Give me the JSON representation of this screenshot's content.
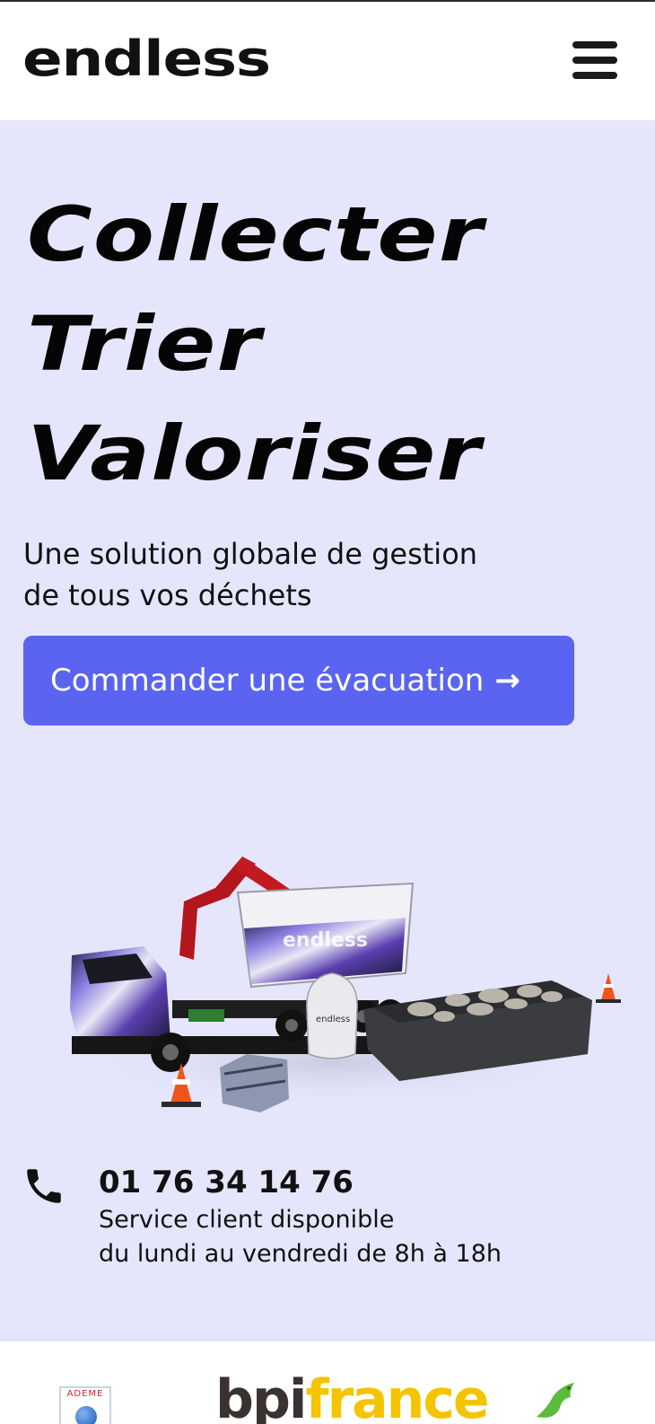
{
  "header": {
    "logo_text": "endless",
    "menu_icon": "hamburger-menu-icon"
  },
  "hero": {
    "headline_lines": [
      "Collecter",
      "Trier",
      "Valoriser"
    ],
    "subtitle_lines": [
      "Une solution globale de gestion",
      "de tous vos déchets"
    ],
    "cta_label": "Commander une évacuation",
    "cta_arrow": "→",
    "truck_brand_text": "endless",
    "bag_label": "endless"
  },
  "contact": {
    "phone_icon": "phone-icon",
    "phone_number": "01 76 34 14 76",
    "hours_lines": [
      "Service client disponible",
      "du lundi au vendredi de 8h à 18h"
    ]
  },
  "partners": {
    "ademe_label": "ADEME",
    "bpi_part1": "bpi",
    "bpi_part2": "france",
    "dove_icon": "dove-logo-icon"
  },
  "colors": {
    "hero_background": "#e5e6fb",
    "cta_background": "#5b64f0",
    "text": "#0a0a0a",
    "bpi_yellow": "#f5c400"
  }
}
